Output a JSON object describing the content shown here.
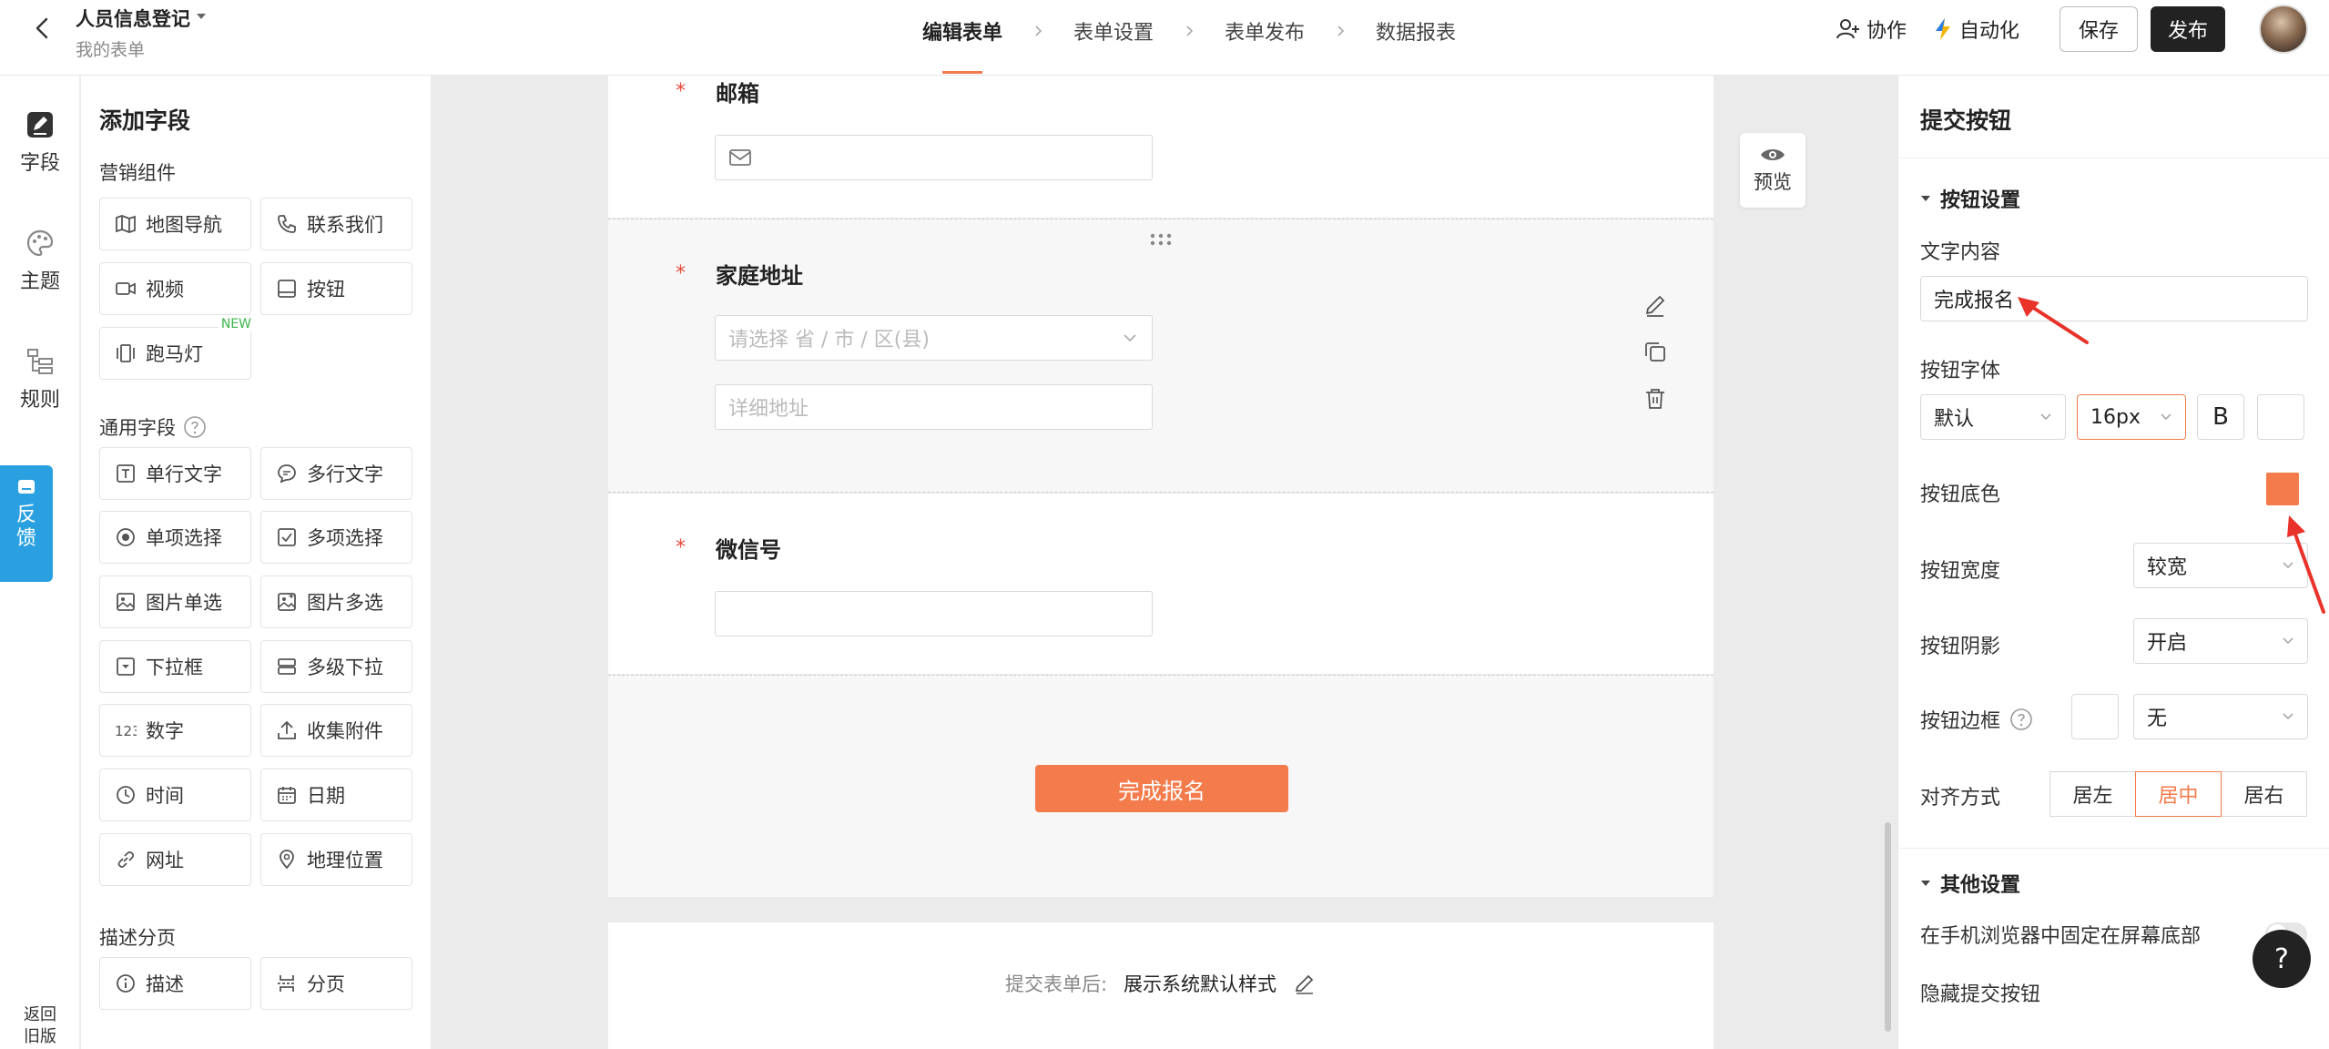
{
  "header": {
    "title": "人员信息登记",
    "subtitle": "我的表单",
    "steps": [
      "编辑表单",
      "表单设置",
      "表单发布",
      "数据报表"
    ],
    "collaborate": "协作",
    "automation": "自动化",
    "save": "保存",
    "publish": "发布"
  },
  "rail": {
    "fields": "字段",
    "theme": "主题",
    "rules": "规则",
    "feedback": [
      "反",
      "馈"
    ],
    "old_version": [
      "返回",
      "旧版"
    ]
  },
  "field_panel": {
    "title": "添加字段",
    "sections": {
      "marketing": "营销组件",
      "common": "通用字段",
      "desc": "描述分页"
    },
    "marketing_items": [
      {
        "label": "地图导航",
        "icon": "map-icon"
      },
      {
        "label": "联系我们",
        "icon": "phone-icon"
      },
      {
        "label": "视频",
        "icon": "video-icon"
      },
      {
        "label": "按钮",
        "icon": "button-icon"
      },
      {
        "label": "跑马灯",
        "icon": "marquee-icon"
      }
    ],
    "new_badge": "NEW",
    "common_items": [
      {
        "label": "单行文字",
        "icon": "text-icon"
      },
      {
        "label": "多行文字",
        "icon": "multiline-icon"
      },
      {
        "label": "单项选择",
        "icon": "radio-icon"
      },
      {
        "label": "多项选择",
        "icon": "checkbox-icon"
      },
      {
        "label": "图片单选",
        "icon": "image-icon"
      },
      {
        "label": "图片多选",
        "icon": "image-multi-icon"
      },
      {
        "label": "下拉框",
        "icon": "dropdown-icon"
      },
      {
        "label": "多级下拉",
        "icon": "cascade-icon"
      },
      {
        "label": "数字",
        "icon": "number-icon"
      },
      {
        "label": "收集附件",
        "icon": "upload-icon"
      },
      {
        "label": "时间",
        "icon": "clock-icon"
      },
      {
        "label": "日期",
        "icon": "calendar-icon"
      },
      {
        "label": "网址",
        "icon": "link-icon"
      },
      {
        "label": "地理位置",
        "icon": "location-icon"
      }
    ],
    "desc_items": [
      {
        "label": "描述",
        "icon": "info-icon"
      },
      {
        "label": "分页",
        "icon": "pagebreak-icon"
      }
    ]
  },
  "form": {
    "email_label": "邮箱",
    "address_label": "家庭地址",
    "address_region_placeholder": "请选择 省 / 市 / 区(县)",
    "address_detail_placeholder": "详细地址",
    "wechat_label": "微信号",
    "required_mark": "*",
    "submit_label": "完成报名",
    "after_submit_label": "提交表单后:",
    "after_submit_value": "展示系统默认样式",
    "preview": "预览"
  },
  "props": {
    "title": "提交按钮",
    "section_button": "按钮设置",
    "text_content_label": "文字内容",
    "text_content_value": "完成报名",
    "font_label": "按钮字体",
    "font_family_value": "默认",
    "font_size_value": "16px",
    "bold_glyph": "B",
    "bg_color_label": "按钮底色",
    "bg_color": "#f47b4b",
    "width_label": "按钮宽度",
    "width_value": "较宽",
    "shadow_label": "按钮阴影",
    "shadow_value": "开启",
    "border_label": "按钮边框",
    "border_value": "无",
    "align_label": "对齐方式",
    "align_options": [
      "居左",
      "居中",
      "居右"
    ],
    "align_selected": "居中",
    "section_other": "其他设置",
    "fixed_bottom_label": "在手机浏览器中固定在屏幕底部",
    "hide_submit_label": "隐藏提交按钮",
    "help": "?"
  },
  "colors": {
    "accent": "#f47b4b",
    "feedback": "#2aa0e0",
    "required": "#e64a3c",
    "annotation_arrow": "#e8322a"
  }
}
